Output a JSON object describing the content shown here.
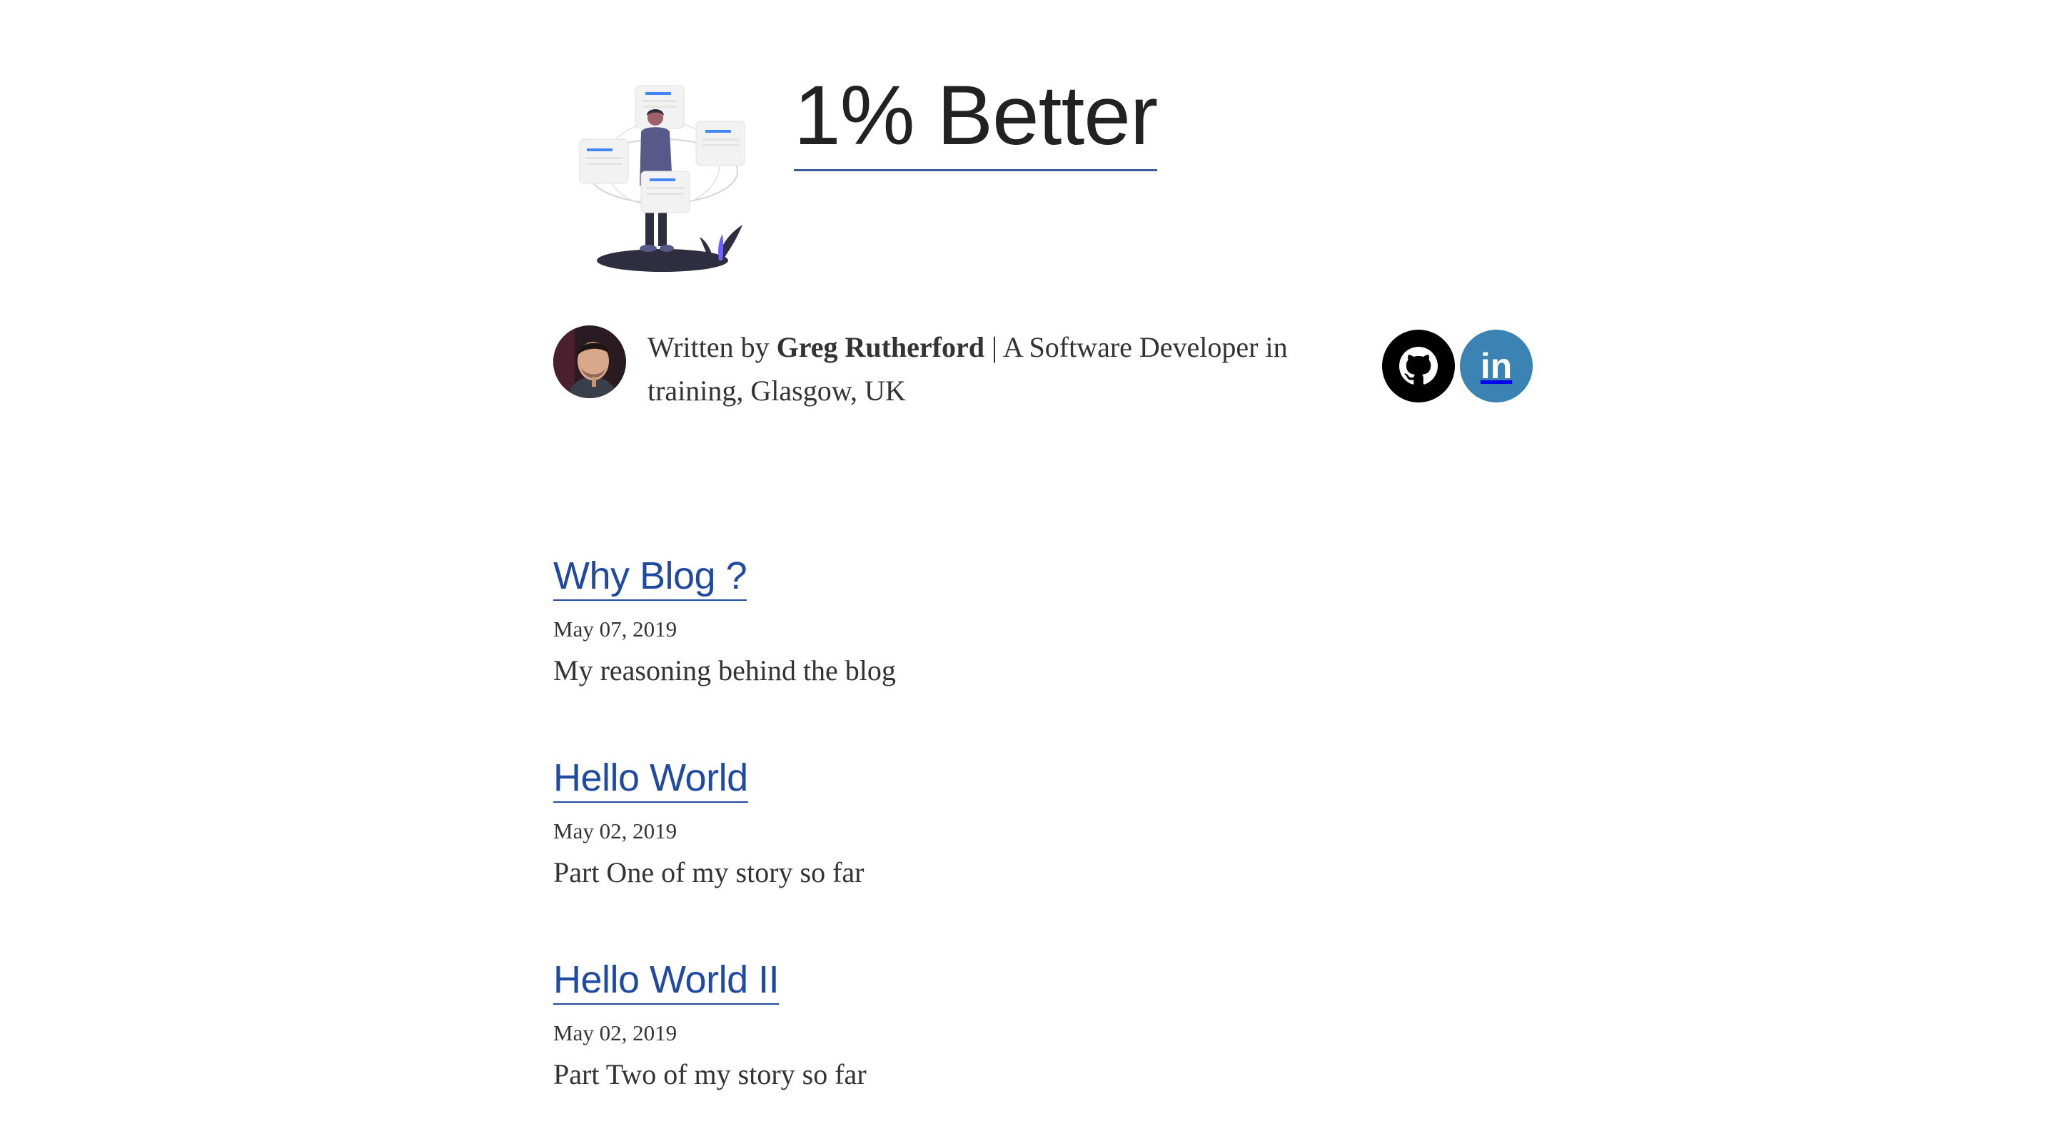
{
  "site": {
    "title": "1% Better"
  },
  "bio": {
    "prefix": "Written by ",
    "author": "Greg Rutherford",
    "suffix": " | A Software Developer in training, Glasgow, UK"
  },
  "social": {
    "github_icon": "github-icon",
    "linkedin_label": "in"
  },
  "colors": {
    "link": "#1f4aa0",
    "github_bg": "#000000",
    "linkedin_bg": "#3b83b3",
    "illustration_accent": "#6c63ff",
    "illustration_blue": "#4285f4"
  },
  "posts": [
    {
      "title": "Why Blog ?",
      "date": "May 07, 2019",
      "description": "My reasoning behind the blog"
    },
    {
      "title": "Hello World",
      "date": "May 02, 2019",
      "description": "Part One of my story so far"
    },
    {
      "title": "Hello World II",
      "date": "May 02, 2019",
      "description": "Part Two of my story so far"
    }
  ]
}
